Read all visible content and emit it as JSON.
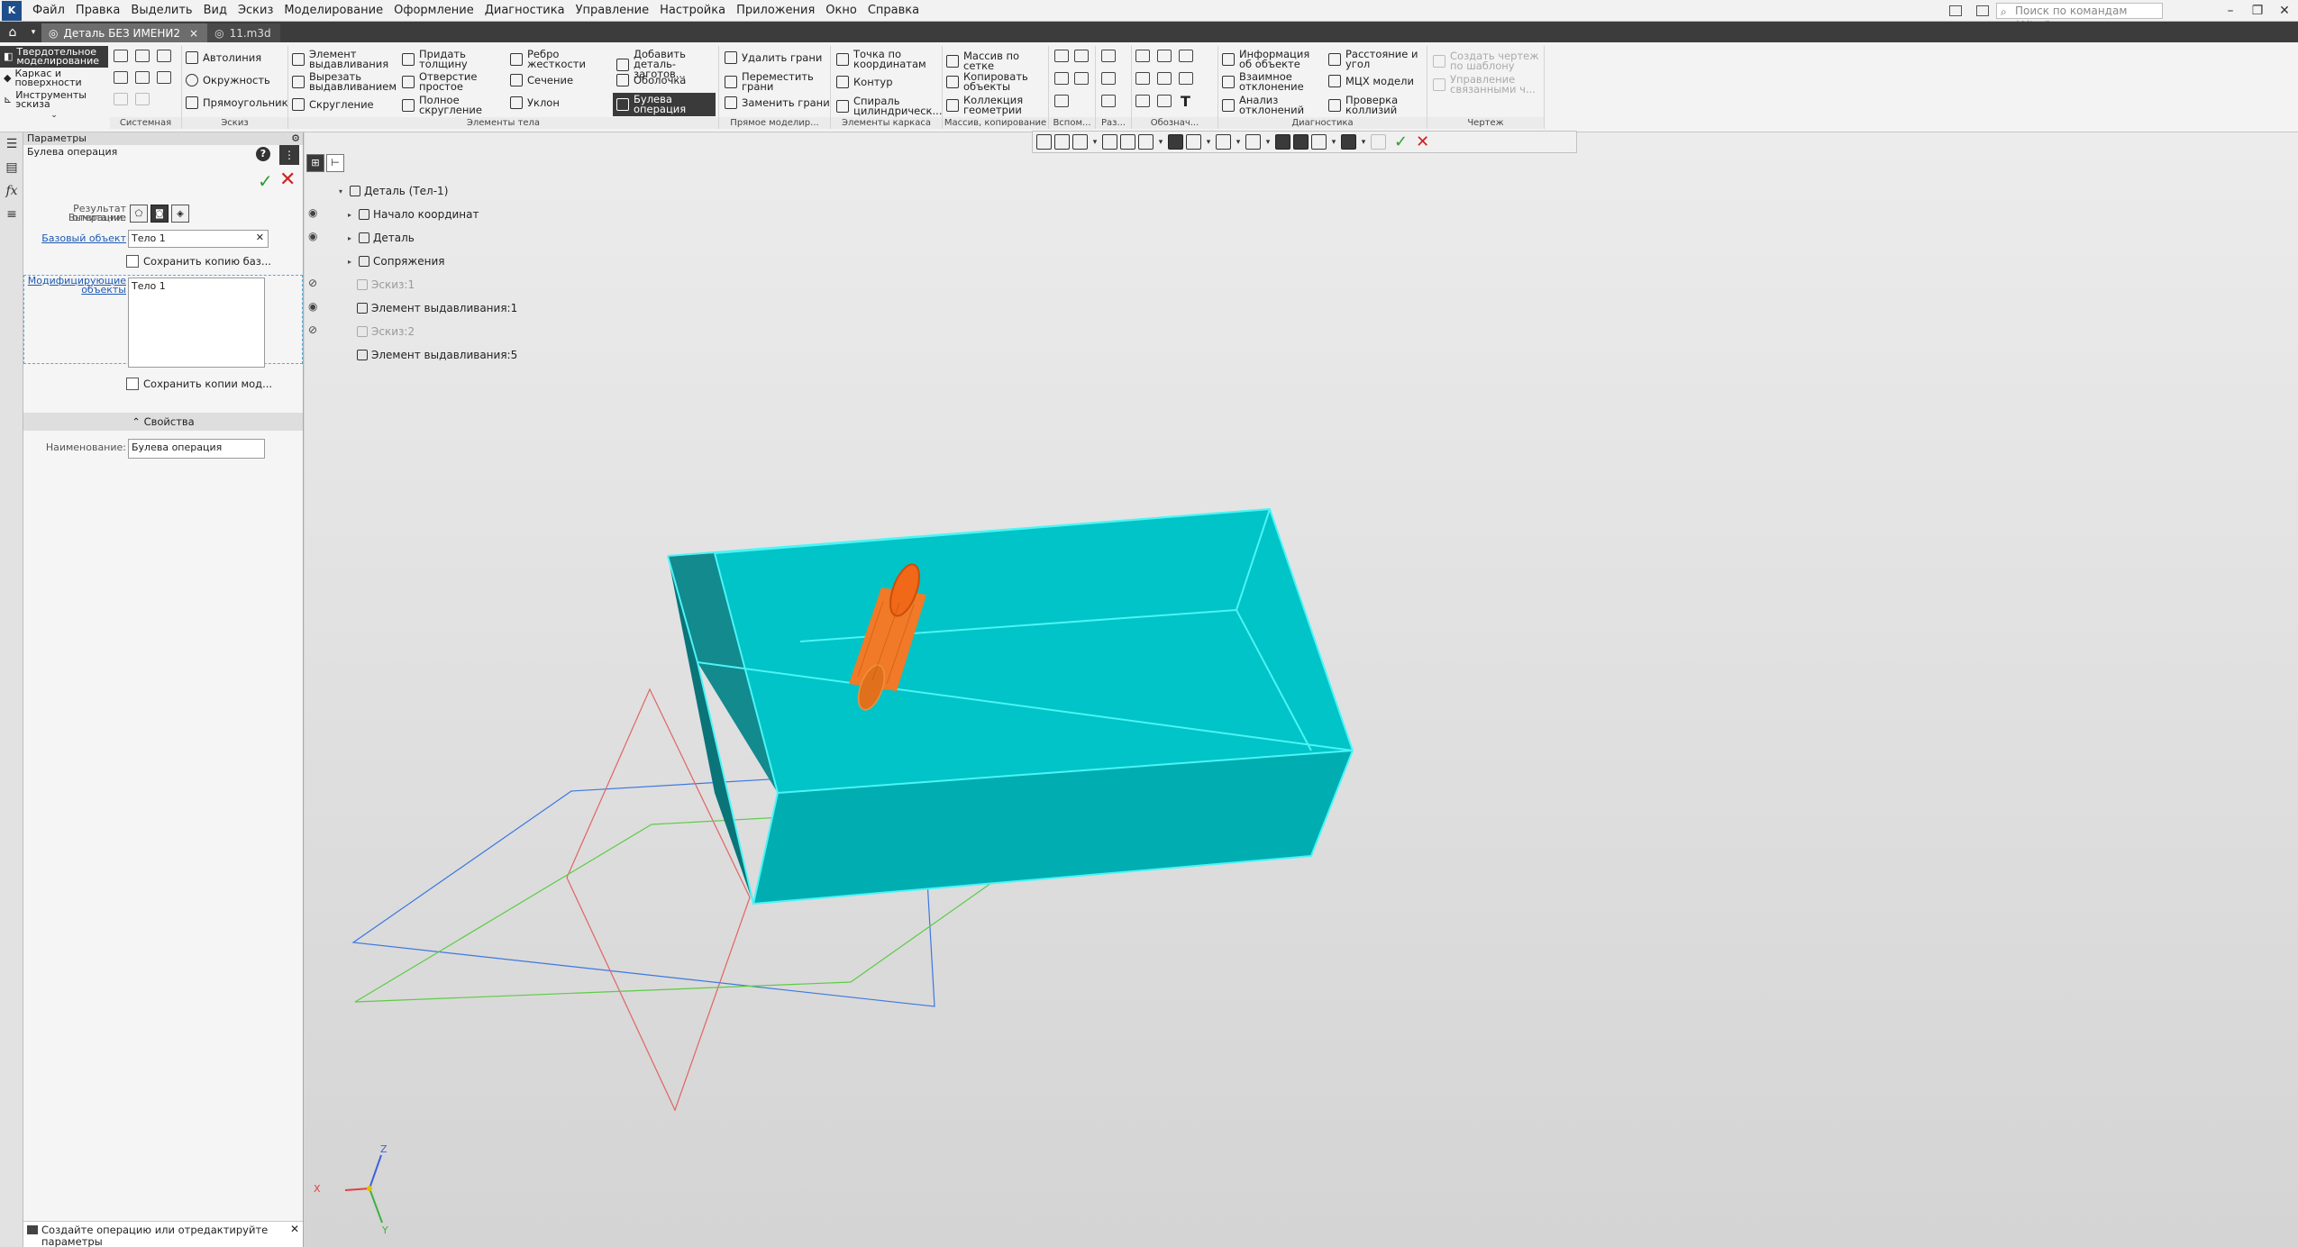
{
  "app": {
    "logo": "K"
  },
  "menu": [
    "Файл",
    "Правка",
    "Выделить",
    "Вид",
    "Эскиз",
    "Моделирование",
    "Оформление",
    "Диагностика",
    "Управление",
    "Настройка",
    "Приложения",
    "Окно",
    "Справка"
  ],
  "search": {
    "placeholder": "Поиск по командам (Alt+/)"
  },
  "tabs": [
    {
      "label": "Деталь БЕЗ ИМЕНИ2",
      "close": "×"
    },
    {
      "label": "11.m3d"
    }
  ],
  "modes": [
    "Твердотельное моделирование",
    "Каркас и поверхности",
    "Инструменты эскиза"
  ],
  "ribbon": {
    "groups": {
      "system": "Системная",
      "sketch": "Эскиз",
      "body": "Элементы тела",
      "direct": "Прямое моделир...",
      "wire": "Элементы каркаса",
      "arrays": "Массив, копирование",
      "aux": "Вспом...",
      "sizes": "Раз...",
      "notations": "Обознач...",
      "diagnostics": "Диагностика",
      "drawing": "Чертеж"
    },
    "sketch_cmds": [
      "Автолиния",
      "Окружность",
      "Прямоугольник"
    ],
    "body_cmds": [
      "Элемент выдавливания",
      "Вырезать выдавливанием",
      "Скругление",
      "Придать толщину",
      "Отверстие простое",
      "Полное скругление",
      "Ребро жесткости",
      "Сечение",
      "Уклон",
      "Добавить деталь-заготов...",
      "Оболочка",
      "Булева операция"
    ],
    "direct_cmds": [
      "Удалить грани",
      "Переместить грани",
      "Заменить грани"
    ],
    "wire_cmds": [
      "Точка по координатам",
      "Контур",
      "Спираль цилиндрическ..."
    ],
    "array_cmds": [
      "Массив по сетке",
      "Копировать объекты",
      "Коллекция геометрии"
    ],
    "diag_cmds": [
      "Информация об объекте",
      "Взаимное отклонение",
      "Анализ отклонений",
      "Расстояние и угол",
      "МЦХ модели",
      "Проверка коллизий"
    ],
    "draw_cmds": [
      "Создать чертеж по шаблону",
      "Управление связанными ч..."
    ]
  },
  "panel": {
    "title": "Параметры",
    "operation": "Булева операция",
    "help": "?",
    "result_label": "Результат операции:",
    "result_value": "Вычитание",
    "base_link": "Базовый объект",
    "base_value": "Тело 1",
    "save_base": "Сохранить копию баз...",
    "modifying_link": "Модифицирующие объекты",
    "modifying_value": "Тело 1",
    "save_mod": "Сохранить копии мод...",
    "props_header": "Свойства",
    "name_label": "Наименование:",
    "name_value": "Булева операция",
    "status": "Создайте операцию или отредактируйте параметры"
  },
  "tree": [
    {
      "label": "Деталь (Тел-1)",
      "dim": false
    },
    {
      "label": "Начало координат",
      "dim": false
    },
    {
      "label": "Деталь",
      "dim": false
    },
    {
      "label": "Сопряжения",
      "dim": false
    },
    {
      "label": "Эскиз:1",
      "dim": true
    },
    {
      "label": "Элемент выдавливания:1",
      "dim": false
    },
    {
      "label": "Эскиз:2",
      "dim": true
    },
    {
      "label": "Элемент выдавливания:5",
      "dim": false
    }
  ],
  "axes": {
    "x": "X",
    "y": "Y",
    "z": "Z"
  },
  "colors": {
    "body": "#00bfc4",
    "body_edge": "#3cf0f5",
    "cylinder": "#f07020",
    "accent_ok": "#2e9d2e",
    "accent_cancel": "#d02020"
  }
}
